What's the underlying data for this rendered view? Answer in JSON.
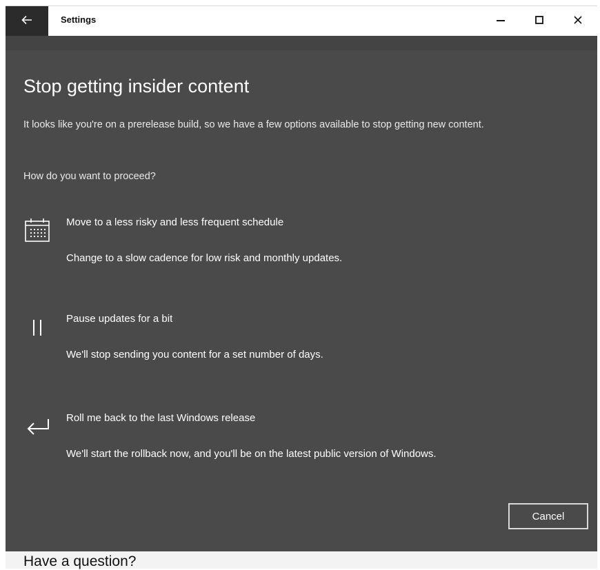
{
  "window": {
    "title": "Settings",
    "icons": {
      "back": "back-arrow-icon",
      "minimize": "minimize-icon",
      "maximize": "maximize-icon",
      "close": "close-icon"
    }
  },
  "dialog": {
    "heading": "Stop getting insider content",
    "description": "It looks like you're on a prerelease build, so we have a few options available to stop getting new content.",
    "question": "How do you want to proceed?",
    "options": [
      {
        "icon": "calendar-icon",
        "title": "Move to a less risky and less frequent schedule",
        "subtitle": "Change to a slow cadence for low risk and monthly updates."
      },
      {
        "icon": "pause-icon",
        "title": "Pause updates for a bit",
        "subtitle": "We'll stop sending you content for a set number of days."
      },
      {
        "icon": "rollback-arrow-icon",
        "title": "Roll me back to the last Windows release",
        "subtitle": "We'll start the rollback now, and you'll be on the latest public version of Windows."
      }
    ],
    "cancel_label": "Cancel"
  },
  "background": {
    "partial_heading": "Have a question?"
  },
  "colors": {
    "dialog_bg": "#4a4a4a",
    "back_button_bg": "#2b2b2b",
    "text": "#ffffff"
  }
}
